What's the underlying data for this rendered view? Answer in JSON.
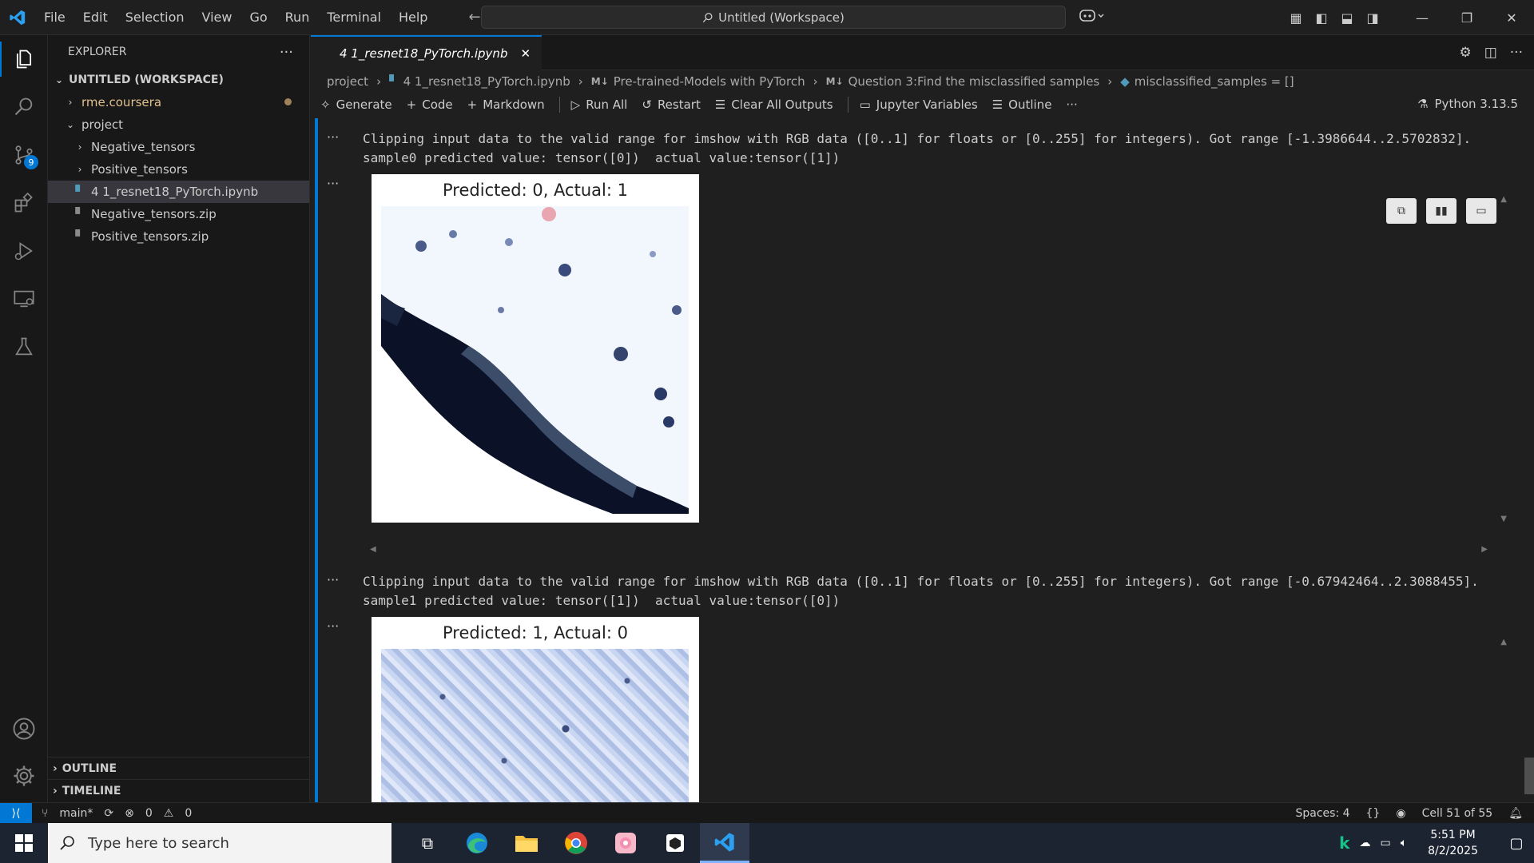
{
  "titlebar": {
    "menu": [
      "File",
      "Edit",
      "Selection",
      "View",
      "Go",
      "Run",
      "Terminal",
      "Help"
    ],
    "command_center": "Untitled (Workspace)"
  },
  "activity_bar": {
    "source_control_badge": "9"
  },
  "explorer": {
    "header": "EXPLORER",
    "workspace": "UNTITLED (WORKSPACE)",
    "items": [
      {
        "label": "rme.coursera",
        "indent": 0
      },
      {
        "label": "project",
        "indent": 0
      },
      {
        "label": "Negative_tensors",
        "indent": 1
      },
      {
        "label": "Positive_tensors",
        "indent": 1
      },
      {
        "label": "4 1_resnet18_PyTorch.ipynb",
        "indent": 1
      },
      {
        "label": "Negative_tensors.zip",
        "indent": 1
      },
      {
        "label": "Positive_tensors.zip",
        "indent": 1
      }
    ],
    "outline": "OUTLINE",
    "timeline": "TIMELINE"
  },
  "editor": {
    "tab": "4 1_resnet18_PyTorch.ipynb",
    "breadcrumb": [
      "project",
      "4 1_resnet18_PyTorch.ipynb",
      "Pre-trained-Models with PyTorch",
      "Question 3:Find the misclassified samples",
      "misclassified_samples = []"
    ],
    "toolbar": {
      "generate": "Generate",
      "code": "Code",
      "markdown": "Markdown",
      "run_all": "Run All",
      "restart": "Restart",
      "clear": "Clear All Outputs",
      "variables": "Jupyter Variables",
      "outline": "Outline",
      "kernel": "Python 3.13.5"
    },
    "outputs": [
      {
        "line1": "Clipping input data to the valid range for imshow with RGB data ([0..1] for floats or [0..255] for integers). Got range [-1.3986644..2.5702832].",
        "line2": "sample0 predicted value: tensor([0])  actual value:tensor([1])",
        "figure_title": "Predicted: 0, Actual: 1"
      },
      {
        "line1": "Clipping input data to the valid range for imshow with RGB data ([0..1] for floats or [0..255] for integers). Got range [-0.67942464..2.3088455].",
        "line2": "sample1 predicted value: tensor([1])  actual value:tensor([0])",
        "figure_title": "Predicted: 1, Actual: 0"
      }
    ]
  },
  "statusbar": {
    "branch": "main*",
    "problems": "0",
    "warnings": "0",
    "spaces": "Spaces: 4",
    "braces": "{}",
    "cell": "Cell 51 of 55"
  },
  "taskbar": {
    "search_placeholder": "Type here to search",
    "time": "5:51 PM",
    "date": "8/2/2025"
  },
  "colors": {
    "accent": "#0078d4",
    "background": "#1f1f1f",
    "sidebar": "#181818"
  }
}
